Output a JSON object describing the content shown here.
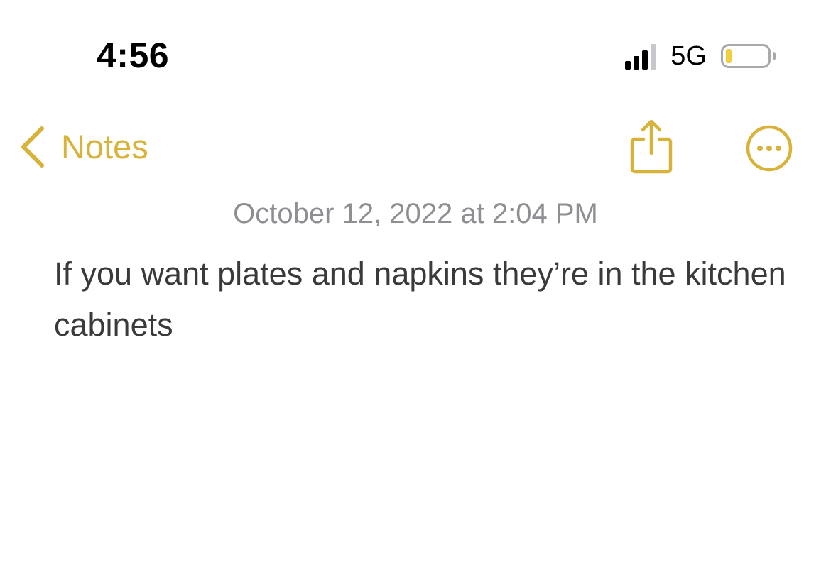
{
  "colors": {
    "accent": "#d9b23a",
    "battery_low": "#f2cd3c",
    "date_text": "#8e8e93",
    "body_text": "#3a3a3c"
  },
  "status_bar": {
    "time": "4:56",
    "network": "5G",
    "signal_icon": "cellular-signal-icon",
    "battery_icon": "battery-low-icon",
    "signal_strength_bars": 3,
    "signal_total_bars": 4
  },
  "nav": {
    "back_label": "Notes",
    "back_icon": "chevron-left-icon",
    "share_icon": "share-icon",
    "more_icon": "ellipsis-circle-icon"
  },
  "note": {
    "date": "October 12, 2022 at 2:04 PM",
    "body": "If you want plates and napkins they’re in the kitchen cabinets"
  }
}
